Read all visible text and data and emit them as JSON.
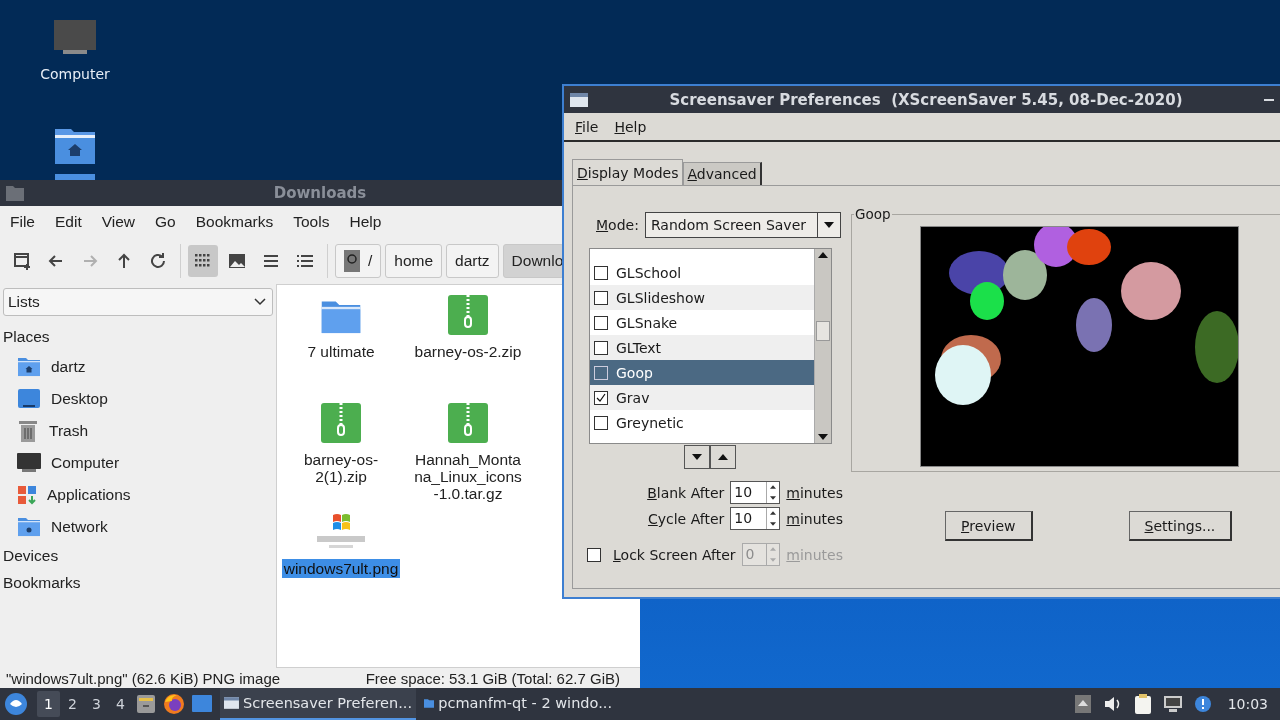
{
  "desktop": {
    "icons": [
      {
        "kind": "computer",
        "label": "Computer"
      },
      {
        "kind": "home-folder"
      }
    ]
  },
  "file_manager": {
    "title": "Downloads",
    "menu": [
      "File",
      "Edit",
      "View",
      "Go",
      "Bookmarks",
      "Tools",
      "Help"
    ],
    "nav": [
      {
        "kind": "new-window",
        "disabled": false
      },
      {
        "kind": "back",
        "disabled": false
      },
      {
        "kind": "forward",
        "disabled": true
      },
      {
        "kind": "up",
        "disabled": false
      },
      {
        "kind": "reload",
        "disabled": false
      }
    ],
    "view_modes": [
      {
        "kind": "icons",
        "selected": true
      },
      {
        "kind": "thumbnails",
        "selected": false
      },
      {
        "kind": "compact",
        "selected": false
      },
      {
        "kind": "details",
        "selected": false
      }
    ],
    "path": [
      {
        "kind": "root",
        "label": "/",
        "selected": false
      },
      {
        "kind": "dir",
        "label": "home",
        "selected": false
      },
      {
        "kind": "dir",
        "label": "dartz",
        "selected": false
      },
      {
        "kind": "dir",
        "label": "Downlo",
        "selected": true
      }
    ],
    "side_pane": {
      "view": "Lists",
      "sections": [
        {
          "title": "Places",
          "items": [
            {
              "kind": "home",
              "label": "dartz"
            },
            {
              "kind": "desktop",
              "label": "Desktop"
            },
            {
              "kind": "trash",
              "label": "Trash"
            },
            {
              "kind": "computer",
              "label": "Computer"
            },
            {
              "kind": "applications",
              "label": "Applications"
            },
            {
              "kind": "network",
              "label": "Network"
            }
          ]
        },
        {
          "title": "Devices"
        },
        {
          "title": "Bookmarks"
        }
      ]
    },
    "files": [
      {
        "kind": "folder",
        "name": "7 ultimate",
        "selected": false
      },
      {
        "kind": "archive",
        "name": "barney-os-2.zip",
        "selected": false
      },
      {
        "kind": "archive",
        "name": "barney-os-2(1).zip",
        "selected": false
      },
      {
        "kind": "archive",
        "name": "Hannah_Montana_Linux_icons-1.0.tar.gz",
        "selected": false
      },
      {
        "kind": "image",
        "name": "windows7ult.png",
        "selected": true
      }
    ],
    "status_bar": {
      "selection": "\"windows7ult.png\" (62.6 KiB) PNG image",
      "free_space": "Free space: 53.1 GiB (Total: 62.7 GiB)"
    }
  },
  "screensaver": {
    "title": "Screensaver Preferences  (XScreenSaver 5.45, 08-Dec-2020)",
    "menu": [
      "File",
      "Help"
    ],
    "tabs": [
      {
        "label": "Display Modes",
        "selected": true
      },
      {
        "label": "Advanced",
        "selected": false
      }
    ],
    "mode": {
      "label": "Mode:",
      "value": "Random Screen Saver"
    },
    "hacks": [
      {
        "name": "GLSchool",
        "checked": false,
        "selected": false
      },
      {
        "name": "GLSlideshow",
        "checked": false,
        "selected": false
      },
      {
        "name": "GLSnake",
        "checked": false,
        "selected": false
      },
      {
        "name": "GLText",
        "checked": false,
        "selected": false
      },
      {
        "name": "Goop",
        "checked": false,
        "selected": true
      },
      {
        "name": "Grav",
        "checked": true,
        "selected": false
      },
      {
        "name": "Greynetic",
        "checked": false,
        "selected": false
      }
    ],
    "timers": [
      {
        "kind": "plain",
        "label": "Blank After",
        "value": "10",
        "unit": "minutes",
        "disabled": false
      },
      {
        "kind": "plain",
        "label": "Cycle After",
        "value": "10",
        "unit": "minutes",
        "disabled": false
      },
      {
        "kind": "checkbox",
        "label": "Lock Screen After",
        "value": "0",
        "unit": "minutes",
        "disabled": true,
        "checked": false
      }
    ],
    "preview": {
      "title": "Goop"
    },
    "buttons": [
      "Preview",
      "Settings..."
    ]
  },
  "taskbar": {
    "workspaces": [
      {
        "label": "1",
        "selected": true
      },
      {
        "label": "2",
        "selected": false
      },
      {
        "label": "3",
        "selected": false
      },
      {
        "label": "4",
        "selected": false
      }
    ],
    "launchers": [
      {
        "kind": "file-manager"
      },
      {
        "kind": "browser"
      },
      {
        "kind": "desktop"
      }
    ],
    "tasks": [
      {
        "label": "Screensaver Preferen...",
        "selected": true
      },
      {
        "label": "pcmanfm-qt - 2 windo...",
        "selected": false
      }
    ],
    "tray": [
      {
        "kind": "eject"
      },
      {
        "kind": "volume"
      },
      {
        "kind": "clipboard"
      },
      {
        "kind": "network"
      },
      {
        "kind": "notification"
      }
    ],
    "clock": "10:03"
  }
}
